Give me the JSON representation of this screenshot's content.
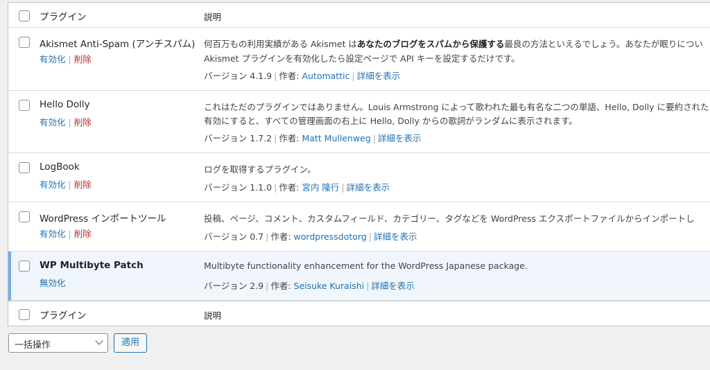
{
  "header": {
    "plugin_label": "プラグイン",
    "desc_label": "説明"
  },
  "footer": {
    "plugin_label": "プラグイン",
    "desc_label": "説明"
  },
  "plugins": [
    {
      "name": "Akismet Anti-Spam (アンチスパム)",
      "action1": "有効化",
      "action2": "削除",
      "desc1_pre": "何百万もの利用実績がある Akismet は",
      "desc1_bold": "あなたのブログをスパムから保護する",
      "desc1_post": "最良の方法といえるでしょう。あなたが眠りについ",
      "desc2": "Akismet プラグインを有効化したら設定ページで API キーを設定するだけです。",
      "version": "バージョン 4.1.9",
      "author_label": "作者:",
      "author": "Automattic",
      "details": "詳細を表示"
    },
    {
      "name": "Hello Dolly",
      "action1": "有効化",
      "action2": "削除",
      "desc1": "これはただのプラグインではありません。Louis Armstrong によって歌われた最も有名な二つの単語、Hello, Dolly に要約された",
      "desc2": "有効にすると、すべての管理画面の右上に Hello, Dolly からの歌詞がランダムに表示されます。",
      "version": "バージョン 1.7.2",
      "author_label": "作者:",
      "author": "Matt Mullenweg",
      "details": "詳細を表示"
    },
    {
      "name": "LogBook",
      "action1": "有効化",
      "action2": "削除",
      "desc1": "ログを取得するプラグイン。",
      "version": "バージョン 1.1.0",
      "author_label": "作者:",
      "author": "宮内 隆行",
      "details": "詳細を表示"
    },
    {
      "name": "WordPress インポートツール",
      "action1": "有効化",
      "action2": "削除",
      "desc1": "投稿、ページ、コメント、カスタムフィールド、カテゴリー、タグなどを WordPress エクスポートファイルからインポートし",
      "version": "バージョン 0.7",
      "author_label": "作者:",
      "author": "wordpressdotorg",
      "details": "詳細を表示"
    },
    {
      "name": "WP Multibyte Patch",
      "action1": "無効化",
      "desc1": "Multibyte functionality enhancement for the WordPress Japanese package.",
      "version": "バージョン 2.9",
      "author_label": "作者:",
      "author": "Seisuke Kuraishi",
      "details": "詳細を表示"
    }
  ],
  "bulk": {
    "label": "一括操作",
    "apply": "適用"
  }
}
